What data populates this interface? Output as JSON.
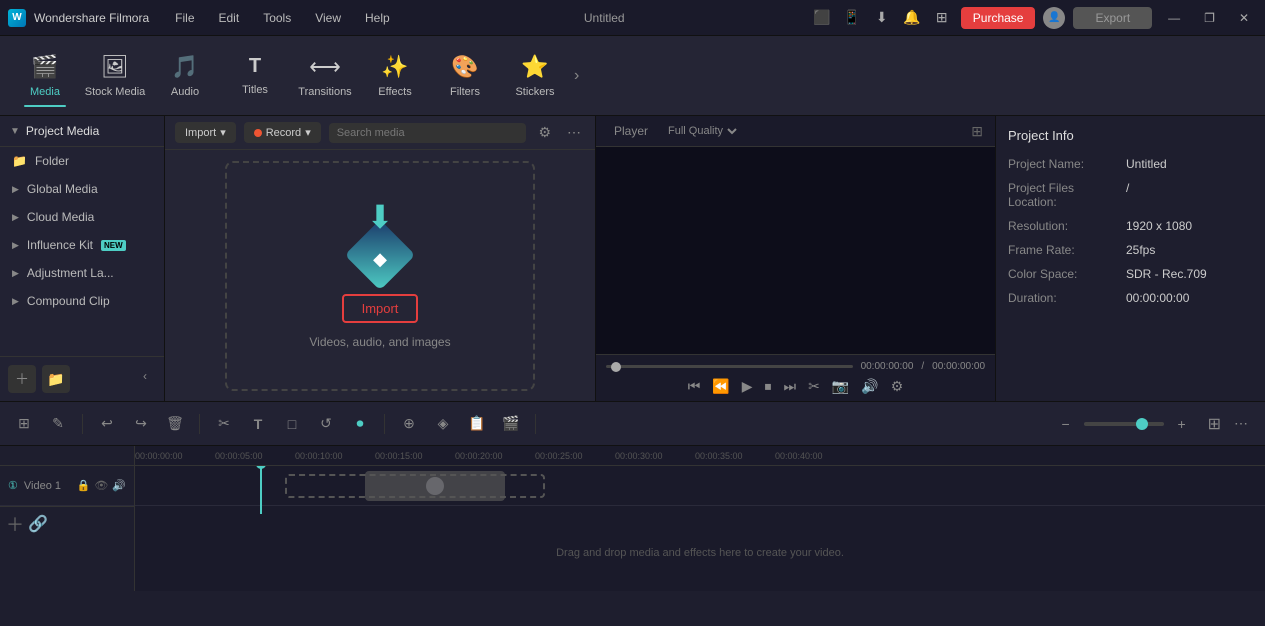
{
  "app": {
    "name": "Wondershare Filmora",
    "title": "Untitled"
  },
  "titlebar": {
    "menus": [
      "File",
      "Edit",
      "Tools",
      "View",
      "Help"
    ],
    "purchase_label": "Purchase",
    "export_label": "Export",
    "window_controls": [
      "—",
      "❐",
      "✕"
    ]
  },
  "toolbar": {
    "items": [
      {
        "id": "media",
        "label": "Media",
        "icon": "🎬",
        "active": true
      },
      {
        "id": "stock-media",
        "label": "Stock Media",
        "icon": "🖼"
      },
      {
        "id": "audio",
        "label": "Audio",
        "icon": "🎵"
      },
      {
        "id": "titles",
        "label": "Titles",
        "icon": "T"
      },
      {
        "id": "transitions",
        "label": "Transitions",
        "icon": "⟷"
      },
      {
        "id": "effects",
        "label": "Effects",
        "icon": "✨"
      },
      {
        "id": "filters",
        "label": "Filters",
        "icon": "🎨"
      },
      {
        "id": "stickers",
        "label": "Stickers",
        "icon": "⭐"
      }
    ],
    "more_icon": "›"
  },
  "sidebar": {
    "header": "Project Media",
    "items": [
      {
        "id": "folder",
        "label": "Folder",
        "has_arrow": false
      },
      {
        "id": "global-media",
        "label": "Global Media",
        "has_arrow": true
      },
      {
        "id": "cloud-media",
        "label": "Cloud Media",
        "has_arrow": true
      },
      {
        "id": "influence-kit",
        "label": "Influence Kit",
        "has_arrow": true,
        "badge": "NEW"
      },
      {
        "id": "adjustment-la",
        "label": "Adjustment La...",
        "has_arrow": true
      },
      {
        "id": "compound-clip",
        "label": "Compound Clip",
        "has_arrow": true
      }
    ],
    "footer_btns": [
      "＋",
      "📁"
    ]
  },
  "media_toolbar": {
    "import_label": "Import",
    "record_label": "Record",
    "search_placeholder": "Search media",
    "filter_icon": "⚙",
    "more_icon": "⋯"
  },
  "import_area": {
    "hint_text": "Videos, audio, and images",
    "import_btn_label": "Import"
  },
  "player": {
    "tab_label": "Player",
    "quality_label": "Full Quality",
    "current_time": "00:00:00:00",
    "total_time": "00:00:00:00",
    "controls": [
      "⏮",
      "⏪",
      "▶",
      "⏹",
      "⏭",
      "✂",
      "📷",
      "🔊",
      "⚙"
    ]
  },
  "project_info": {
    "title": "Project Info",
    "name_label": "Project Name:",
    "name_value": "Untitled",
    "files_label": "Project Files Location:",
    "files_value": "/",
    "resolution_label": "Resolution:",
    "resolution_value": "1920 x 1080",
    "framerate_label": "Frame Rate:",
    "framerate_value": "25fps",
    "colorspace_label": "Color Space:",
    "colorspace_value": "SDR - Rec.709",
    "duration_label": "Duration:",
    "duration_value": "00:00:00:00"
  },
  "timeline": {
    "toolbar_btns": [
      "⊞",
      "✎",
      "↩",
      "↪",
      "🗑",
      "✂",
      "T",
      "□",
      "↺",
      "⏺",
      "⊕",
      "◈",
      "📋",
      "🎬"
    ],
    "zoom_minus": "−",
    "zoom_plus": "+",
    "view_btn": "⊞",
    "ruler_marks": [
      "00:00:05:00",
      "00:00:10:00",
      "00:00:15:00",
      "00:00:20:00",
      "00:00:25:00",
      "00:00:30:00",
      "00:00:35:00",
      "00:00:40:00"
    ],
    "tracks": [
      {
        "id": "video1",
        "label": "Video 1",
        "icons": [
          "🔒",
          "👁"
        ]
      }
    ],
    "drop_hint": "Drag and drop media and effects here to create your video."
  }
}
